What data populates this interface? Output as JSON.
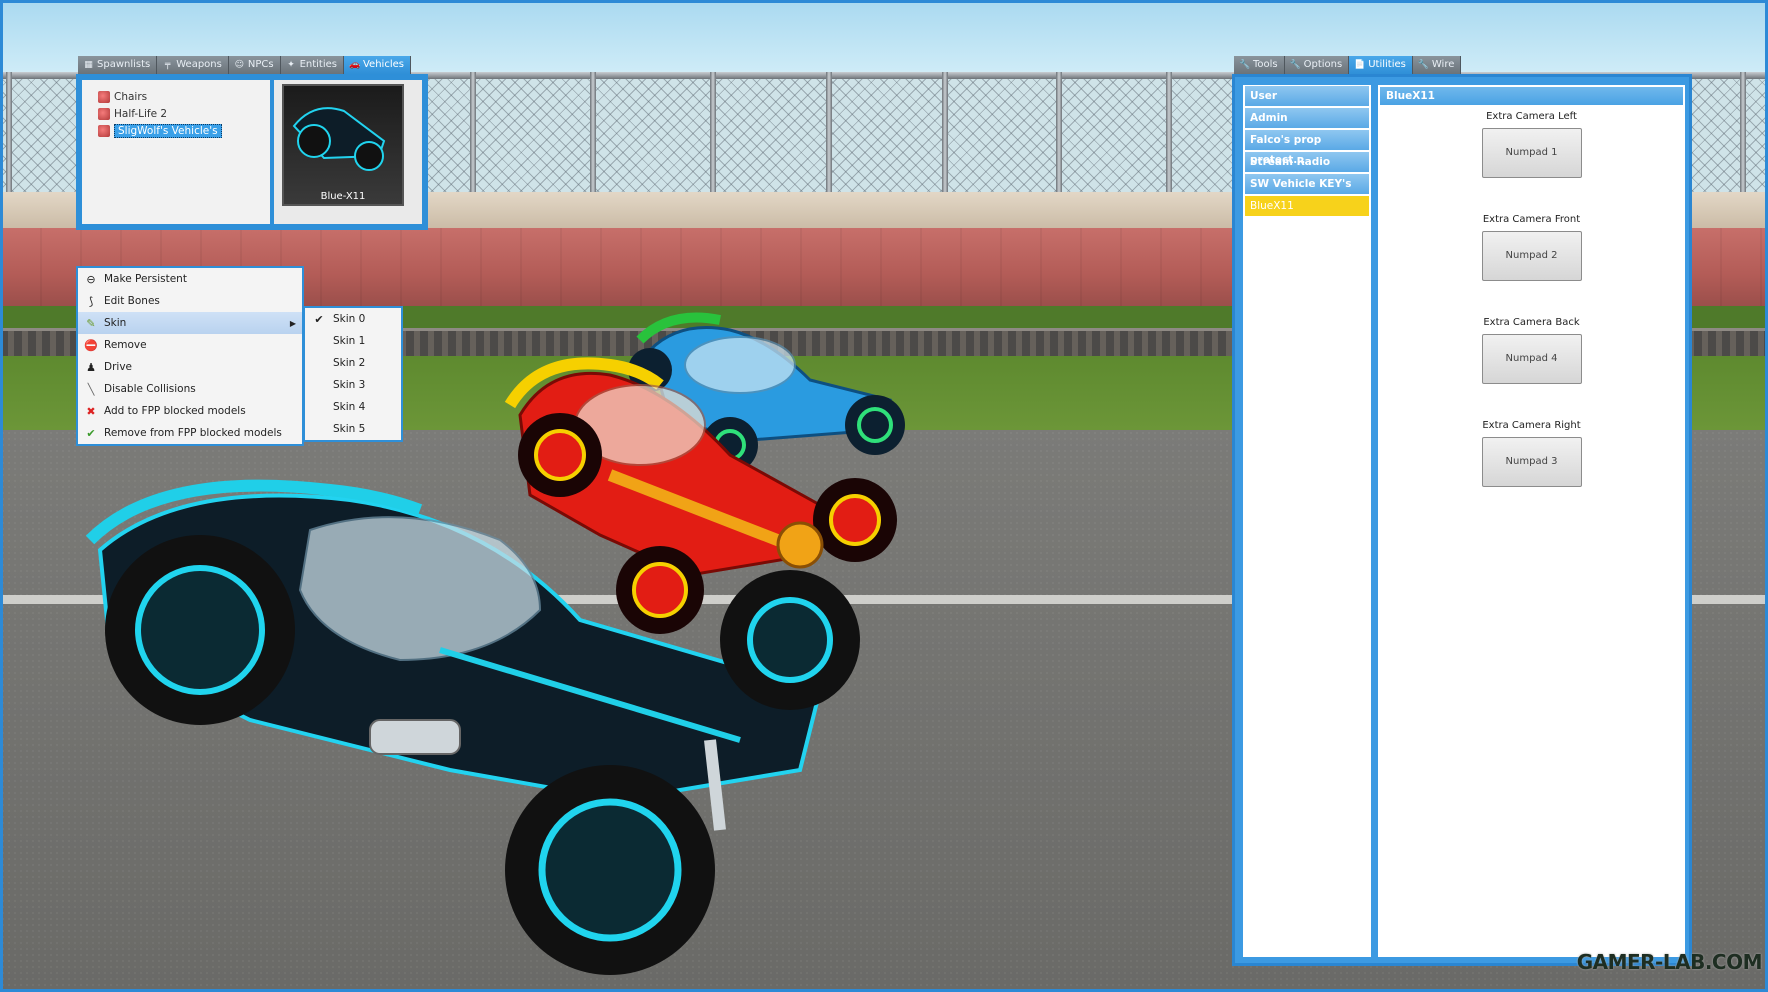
{
  "spawnmenu": {
    "tabs": [
      {
        "label": "Spawnlists",
        "icon": "grid-icon",
        "active": false
      },
      {
        "label": "Weapons",
        "icon": "gun-icon",
        "active": false
      },
      {
        "label": "NPCs",
        "icon": "face-icon",
        "active": false
      },
      {
        "label": "Entities",
        "icon": "entity-icon",
        "active": false
      },
      {
        "label": "Vehicles",
        "icon": "car-icon",
        "active": true
      }
    ],
    "tree": [
      {
        "label": "Chairs",
        "selected": false
      },
      {
        "label": "Half-Life 2",
        "selected": false
      },
      {
        "label": "SligWolf's Vehicle's",
        "selected": true
      }
    ],
    "thumbnail_label": "Blue-X11"
  },
  "context_menu": {
    "items": [
      {
        "label": "Make Persistent",
        "icon": "link-icon"
      },
      {
        "label": "Edit Bones",
        "icon": "bone-icon"
      },
      {
        "label": "Skin",
        "icon": "paint-icon",
        "highlighted": true,
        "submenu": true
      },
      {
        "label": "Remove",
        "icon": "remove-icon"
      },
      {
        "label": "Drive",
        "icon": "person-icon"
      },
      {
        "label": "Disable Collisions",
        "icon": "slash-icon"
      },
      {
        "label": "Add to FPP blocked models",
        "icon": "x-icon"
      },
      {
        "label": "Remove from FPP blocked models",
        "icon": "check-icon"
      }
    ],
    "skin_submenu": [
      {
        "label": "Skin 0",
        "checked": true
      },
      {
        "label": "Skin 1",
        "checked": false
      },
      {
        "label": "Skin 2",
        "checked": false
      },
      {
        "label": "Skin 3",
        "checked": false
      },
      {
        "label": "Skin 4",
        "checked": false
      },
      {
        "label": "Skin 5",
        "checked": false
      }
    ]
  },
  "tool_menu": {
    "tabs": [
      {
        "label": "Tools",
        "icon": "wrench-icon",
        "active": false
      },
      {
        "label": "Options",
        "icon": "wrench-icon",
        "active": false
      },
      {
        "label": "Utilities",
        "icon": "page-icon",
        "active": true
      },
      {
        "label": "Wire",
        "icon": "wrench-icon",
        "active": false
      }
    ],
    "categories": [
      {
        "label": "User",
        "active": false
      },
      {
        "label": "Admin",
        "active": false
      },
      {
        "label": "Falco's prop protect...",
        "active": false
      },
      {
        "label": "Stream Radio",
        "active": false
      },
      {
        "label": "SW Vehicle KEY's",
        "active": false
      },
      {
        "label": "BlueX11",
        "active": true
      }
    ],
    "panel_title": "BlueX11",
    "bindings": [
      {
        "label": "Extra Camera Left",
        "key": "Numpad 1"
      },
      {
        "label": "Extra Camera Front",
        "key": "Numpad 2"
      },
      {
        "label": "Extra Camera Back",
        "key": "Numpad 4"
      },
      {
        "label": "Extra Camera Right",
        "key": "Numpad 3"
      }
    ]
  },
  "watermark": "GAMER-LAB.COM",
  "colors": {
    "accent": "#2e8fd8",
    "category": "#5aa9e6",
    "selected_category": "#f7d21b"
  }
}
